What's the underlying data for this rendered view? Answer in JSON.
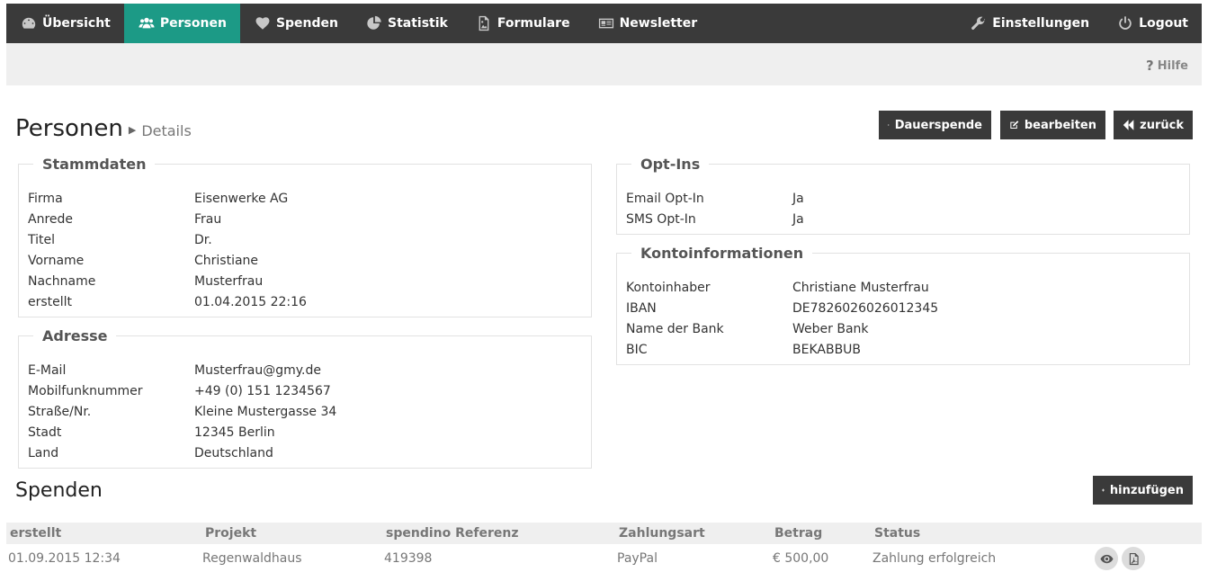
{
  "nav": {
    "items": [
      {
        "label": "Übersicht",
        "icon": "dashboard-icon"
      },
      {
        "label": "Personen",
        "icon": "users-icon"
      },
      {
        "label": "Spenden",
        "icon": "heart-icon"
      },
      {
        "label": "Statistik",
        "icon": "pie-chart-icon"
      },
      {
        "label": "Formulare",
        "icon": "image-file-icon"
      },
      {
        "label": "Newsletter",
        "icon": "newspaper-icon"
      }
    ],
    "settings_label": "Einstellungen",
    "logout_label": "Logout"
  },
  "help_label": "Hilfe",
  "page": {
    "title": "Personen",
    "subtitle": "Details"
  },
  "buttons": {
    "dauerspende": "Dauerspende",
    "bearbeiten": "bearbeiten",
    "zurueck": "zurück",
    "hinzufuegen": "hinzufügen"
  },
  "stammdaten": {
    "legend": "Stammdaten",
    "rows": [
      {
        "label": "Firma",
        "value": "Eisenwerke AG"
      },
      {
        "label": "Anrede",
        "value": "Frau"
      },
      {
        "label": "Titel",
        "value": "Dr."
      },
      {
        "label": "Vorname",
        "value": "Christiane"
      },
      {
        "label": "Nachname",
        "value": "Musterfrau"
      },
      {
        "label": "erstellt",
        "value": "01.04.2015 22:16"
      }
    ]
  },
  "adresse": {
    "legend": "Adresse",
    "rows": [
      {
        "label": "E-Mail",
        "value": "Musterfrau@gmy.de"
      },
      {
        "label": "Mobilfunknummer",
        "value": "+49 (0) 151 1234567"
      },
      {
        "label": "Straße/Nr.",
        "value": "Kleine Mustergasse 34"
      },
      {
        "label": "Stadt",
        "value": "12345 Berlin"
      },
      {
        "label": "Land",
        "value": "Deutschland"
      }
    ]
  },
  "optins": {
    "legend": "Opt-Ins",
    "rows": [
      {
        "label": "Email Opt-In",
        "value": "Ja"
      },
      {
        "label": "SMS Opt-In",
        "value": "Ja"
      }
    ]
  },
  "konto": {
    "legend": "Kontoinformationen",
    "rows": [
      {
        "label": "Kontoinhaber",
        "value": "Christiane Musterfrau"
      },
      {
        "label": "IBAN",
        "value": "DE7826026026012345"
      },
      {
        "label": "Name der Bank",
        "value": "Weber Bank"
      },
      {
        "label": "BIC",
        "value": "BEKABBUB"
      }
    ]
  },
  "spenden": {
    "title": "Spenden",
    "columns": [
      "erstellt",
      "Projekt",
      "spendino Referenz",
      "Zahlungsart",
      "Betrag",
      "Status"
    ],
    "rows": [
      {
        "erstellt": "01.09.2015 12:34",
        "projekt": "Regenwaldhaus",
        "referenz": "419398",
        "zahlungsart": "PayPal",
        "betrag": "€ 500,00",
        "status": "Zahlung erfolgreich"
      }
    ]
  }
}
